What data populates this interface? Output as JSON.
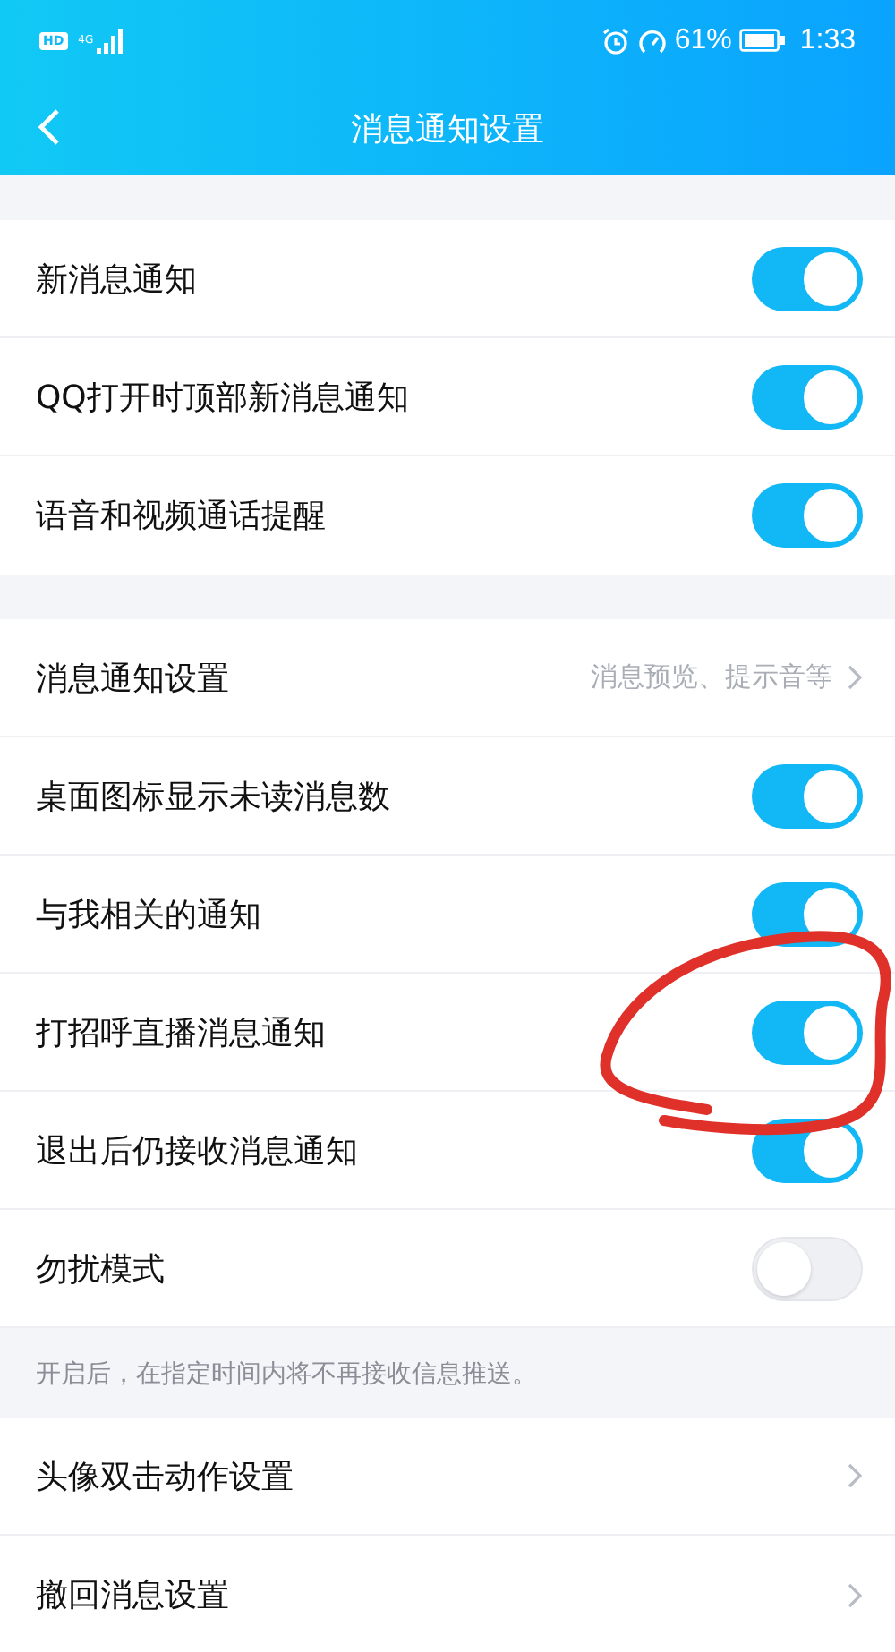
{
  "status_bar": {
    "hd": "HD",
    "network": "4G",
    "battery": "61%",
    "time": "1:33"
  },
  "nav": {
    "title": "消息通知设置"
  },
  "groups": [
    {
      "rows": [
        {
          "kind": "toggle",
          "label": "新消息通知",
          "on": true
        },
        {
          "kind": "toggle",
          "label": "QQ打开时顶部新消息通知",
          "on": true
        },
        {
          "kind": "toggle",
          "label": "语音和视频通话提醒",
          "on": true
        }
      ]
    },
    {
      "rows": [
        {
          "kind": "link",
          "label": "消息通知设置",
          "detail": "消息预览、提示音等"
        },
        {
          "kind": "toggle",
          "label": "桌面图标显示未读消息数",
          "on": true
        },
        {
          "kind": "toggle",
          "label": "与我相关的通知",
          "on": true
        },
        {
          "kind": "toggle",
          "label": "打招呼直播消息通知",
          "on": true,
          "circled": true
        },
        {
          "kind": "toggle",
          "label": "退出后仍接收消息通知",
          "on": true
        },
        {
          "kind": "toggle",
          "label": "勿扰模式",
          "on": false
        }
      ],
      "hint": "开启后，在指定时间内将不再接收信息推送。"
    },
    {
      "rows": [
        {
          "kind": "link",
          "label": "头像双击动作设置"
        },
        {
          "kind": "link",
          "label": "撤回消息设置"
        }
      ]
    }
  ]
}
